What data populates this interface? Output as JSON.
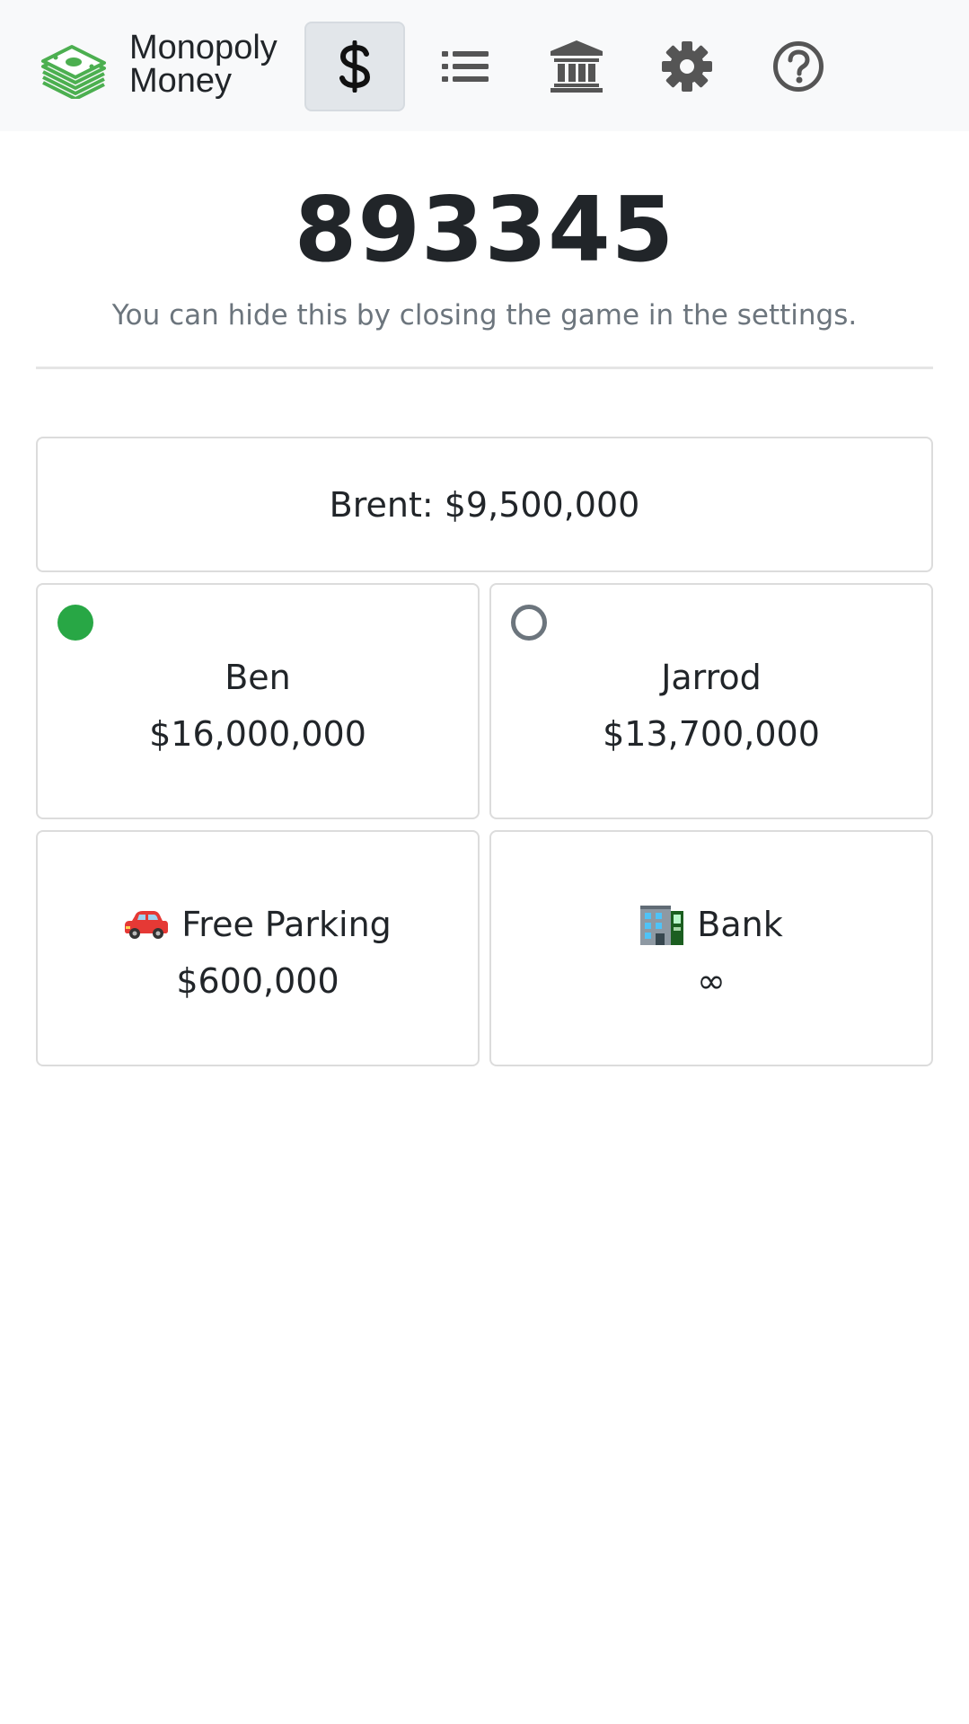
{
  "brand": {
    "line1": "Monopoly",
    "line2": "Money"
  },
  "nav": {
    "items": [
      {
        "name": "dollar-icon",
        "active": true
      },
      {
        "name": "list-icon",
        "active": false
      },
      {
        "name": "bank-icon",
        "active": false
      },
      {
        "name": "gear-icon",
        "active": false
      },
      {
        "name": "help-icon",
        "active": false
      }
    ]
  },
  "game": {
    "code": "893345",
    "hint": "You can hide this by closing the game in the settings."
  },
  "self_card": {
    "label": "Brent: $9,500,000"
  },
  "players": [
    {
      "name": "Ben",
      "amount": "$16,000,000",
      "status": "active"
    },
    {
      "name": "Jarrod",
      "amount": "$13,700,000",
      "status": "inactive"
    }
  ],
  "free_parking": {
    "label": "Free Parking",
    "amount": "$600,000",
    "icon": "car-icon"
  },
  "bank": {
    "label": "Bank",
    "amount": "∞",
    "icon": "building-icon"
  },
  "colors": {
    "accent_green": "#28a745",
    "inactive_gray": "#6c757d",
    "logo_green": "#4caf50"
  }
}
